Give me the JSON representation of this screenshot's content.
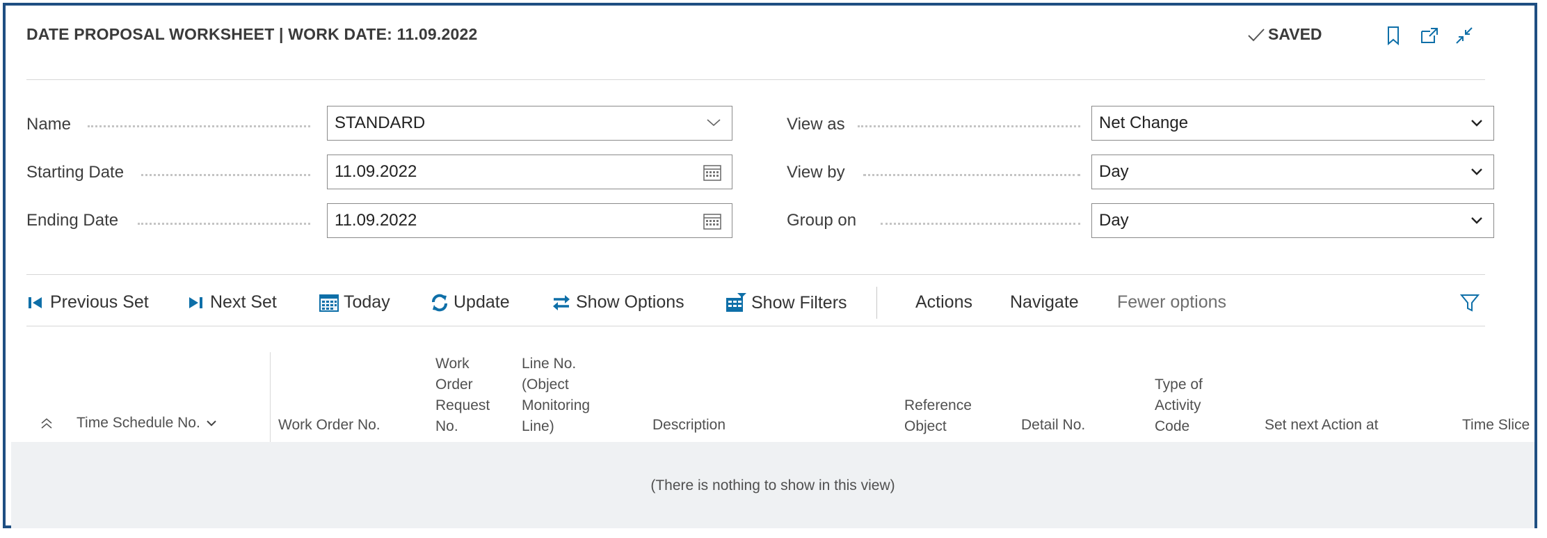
{
  "header": {
    "title": "DATE PROPOSAL WORKSHEET | WORK DATE: 11.09.2022",
    "saved_label": "SAVED",
    "icons": [
      "bookmark-icon",
      "open-new-window-icon",
      "collapse-icon"
    ]
  },
  "form": {
    "name": {
      "label": "Name",
      "value": "STANDARD"
    },
    "starting_date": {
      "label": "Starting Date",
      "value": "11.09.2022"
    },
    "ending_date": {
      "label": "Ending Date",
      "value": "11.09.2022"
    },
    "view_as": {
      "label": "View as",
      "value": "Net Change"
    },
    "view_by": {
      "label": "View by",
      "value": "Day"
    },
    "group_on": {
      "label": "Group on",
      "value": "Day"
    }
  },
  "toolbar": {
    "previous_set": "Previous Set",
    "next_set": "Next Set",
    "today": "Today",
    "update": "Update",
    "show_options": "Show Options",
    "show_filters": "Show Filters",
    "actions": "Actions",
    "navigate": "Navigate",
    "fewer_options": "Fewer options"
  },
  "table": {
    "columns": {
      "time_schedule_no": "Time Schedule No.",
      "work_order_no": "Work Order No.",
      "work_order_request_no": [
        "Work",
        "Order",
        "Request",
        "No."
      ],
      "line_no": [
        "Line No.",
        "(Object",
        "Monitoring",
        "Line)"
      ],
      "description": "Description",
      "reference_object": [
        "Reference",
        "Object"
      ],
      "detail_no": "Detail No.",
      "type_of_activity_code": [
        "Type of",
        "Activity",
        "Code"
      ],
      "set_next_action_at": "Set next Action at",
      "time_slice": "Time Slice"
    },
    "empty_message": "(There is nothing to show in this view)"
  },
  "colors": {
    "frame_border": "#1f4f82",
    "accent_icon": "#0e6fa8",
    "empty_background": "#eff1f3"
  }
}
